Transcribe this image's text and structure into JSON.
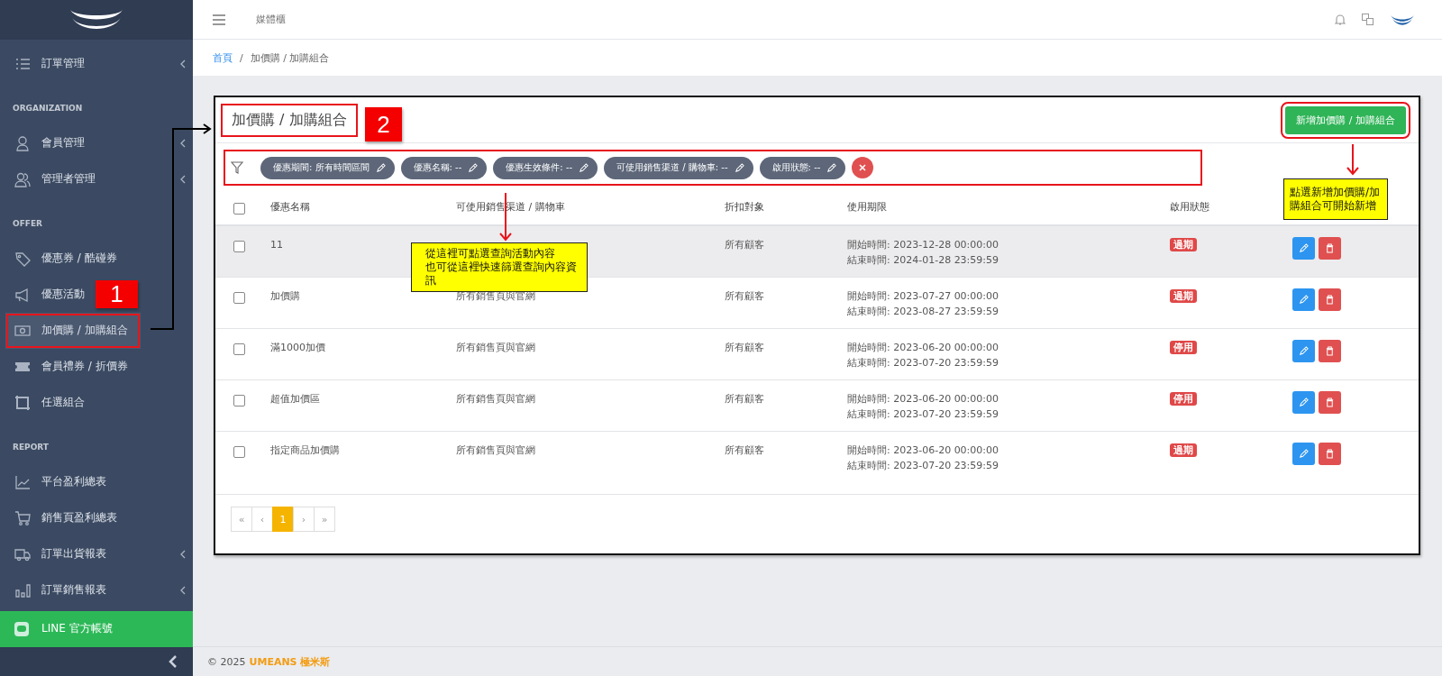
{
  "sidebar": {
    "groups": [
      {
        "items": [
          {
            "label": "訂單管理",
            "expandable": true,
            "selected": false
          }
        ]
      },
      {
        "heading": "ORGANIZATION",
        "items": [
          {
            "label": "會員管理",
            "expandable": true,
            "selected": false
          },
          {
            "label": "管理者管理",
            "expandable": true,
            "selected": false
          }
        ]
      },
      {
        "heading": "OFFER",
        "items": [
          {
            "label": "優惠券 / 酷碰券",
            "expandable": false,
            "selected": false
          },
          {
            "label": "優惠活動",
            "expandable": false,
            "selected": false
          },
          {
            "label": "加價購 / 加購組合",
            "expandable": false,
            "selected": true
          },
          {
            "label": "會員禮券 / 折價券",
            "expandable": false,
            "selected": false
          },
          {
            "label": "任選組合",
            "expandable": false,
            "selected": false
          }
        ]
      },
      {
        "heading": "REPORT",
        "items": [
          {
            "label": "平台盈利總表",
            "expandable": false,
            "selected": false
          },
          {
            "label": "銷售頁盈利總表",
            "expandable": false,
            "selected": false
          },
          {
            "label": "訂單出貨報表",
            "expandable": true,
            "selected": false
          },
          {
            "label": "訂單銷售報表",
            "expandable": true,
            "selected": false
          }
        ]
      }
    ],
    "line_item": {
      "label": "LINE 官方帳號"
    }
  },
  "topbar": {
    "title": "媒體櫃"
  },
  "breadcrumb": {
    "separator": "/",
    "items": [
      {
        "label": "首頁",
        "link": true
      },
      {
        "label": "加價購 / 加購組合",
        "link": false
      }
    ]
  },
  "card": {
    "title": "加價購 / 加購組合",
    "add_button": "新增加價購 / 加購組合",
    "filters": [
      {
        "label": "優惠期間: 所有時間區間"
      },
      {
        "label": "優惠名稱: --"
      },
      {
        "label": "優惠生效條件: --"
      },
      {
        "label": "可使用銷售渠道 / 購物車: --"
      },
      {
        "label": "啟用狀態: --"
      }
    ],
    "table": {
      "select_all": {
        "checked": false
      },
      "columns": [
        "優惠名稱",
        "可使用銷售渠道 / 購物車",
        "折扣對象",
        "使用期限",
        "啟用狀態"
      ],
      "rows": [
        {
          "checked": false,
          "highlighted": true,
          "name": "11",
          "target": "所有顧客",
          "start": "開始時間: 2023-12-28 00:00:00",
          "end": "結束時間: 2024-01-28 23:59:59",
          "status": {
            "label": "過期"
          }
        },
        {
          "checked": false,
          "highlighted": false,
          "name": "加價購",
          "channel": "所有銷售頁與官網",
          "target": "所有顧客",
          "start": "開始時間: 2023-07-27 00:00:00",
          "end": "結束時間: 2023-08-27 23:59:59",
          "status": {
            "label": "過期"
          }
        },
        {
          "checked": false,
          "highlighted": false,
          "name": "滿1000加價",
          "channel": "所有銷售頁與官網",
          "target": "所有顧客",
          "start": "開始時間: 2023-06-20 00:00:00",
          "end": "結束時間: 2023-07-20 23:59:59",
          "status": {
            "label": "停用"
          }
        },
        {
          "checked": false,
          "highlighted": false,
          "name": "超值加價區",
          "channel": "所有銷售頁與官網",
          "target": "所有顧客",
          "start": "開始時間: 2023-06-20 00:00:00",
          "end": "結束時間: 2023-07-20 23:59:59",
          "status": {
            "label": "停用"
          }
        },
        {
          "checked": false,
          "highlighted": false,
          "name": "指定商品加價購",
          "channel": "所有銷售頁與官網",
          "target": "所有顧客",
          "start": "開始時間: 2023-06-20 00:00:00",
          "end": "結束時間: 2023-07-20 23:59:59",
          "status": {
            "label": "過期"
          }
        }
      ]
    },
    "pagination": [
      {
        "label": "«",
        "selected": false
      },
      {
        "label": "‹",
        "selected": false
      },
      {
        "label": "1",
        "selected": true
      },
      {
        "label": "›",
        "selected": false
      },
      {
        "label": "»",
        "selected": false
      }
    ]
  },
  "footer": {
    "copyright": "© 2025",
    "brand": "UMEANS 極米斯"
  },
  "annotations": {
    "markers": [
      {
        "label": "1"
      },
      {
        "label": "2"
      }
    ],
    "callouts": [
      {
        "lines": [
          "從這裡可點選查詢活動內容",
          "也可從這裡快速篩選查詢內容資訊"
        ]
      },
      {
        "lines": [
          "點選新增加價購/加購組合可開始新增"
        ]
      }
    ]
  }
}
